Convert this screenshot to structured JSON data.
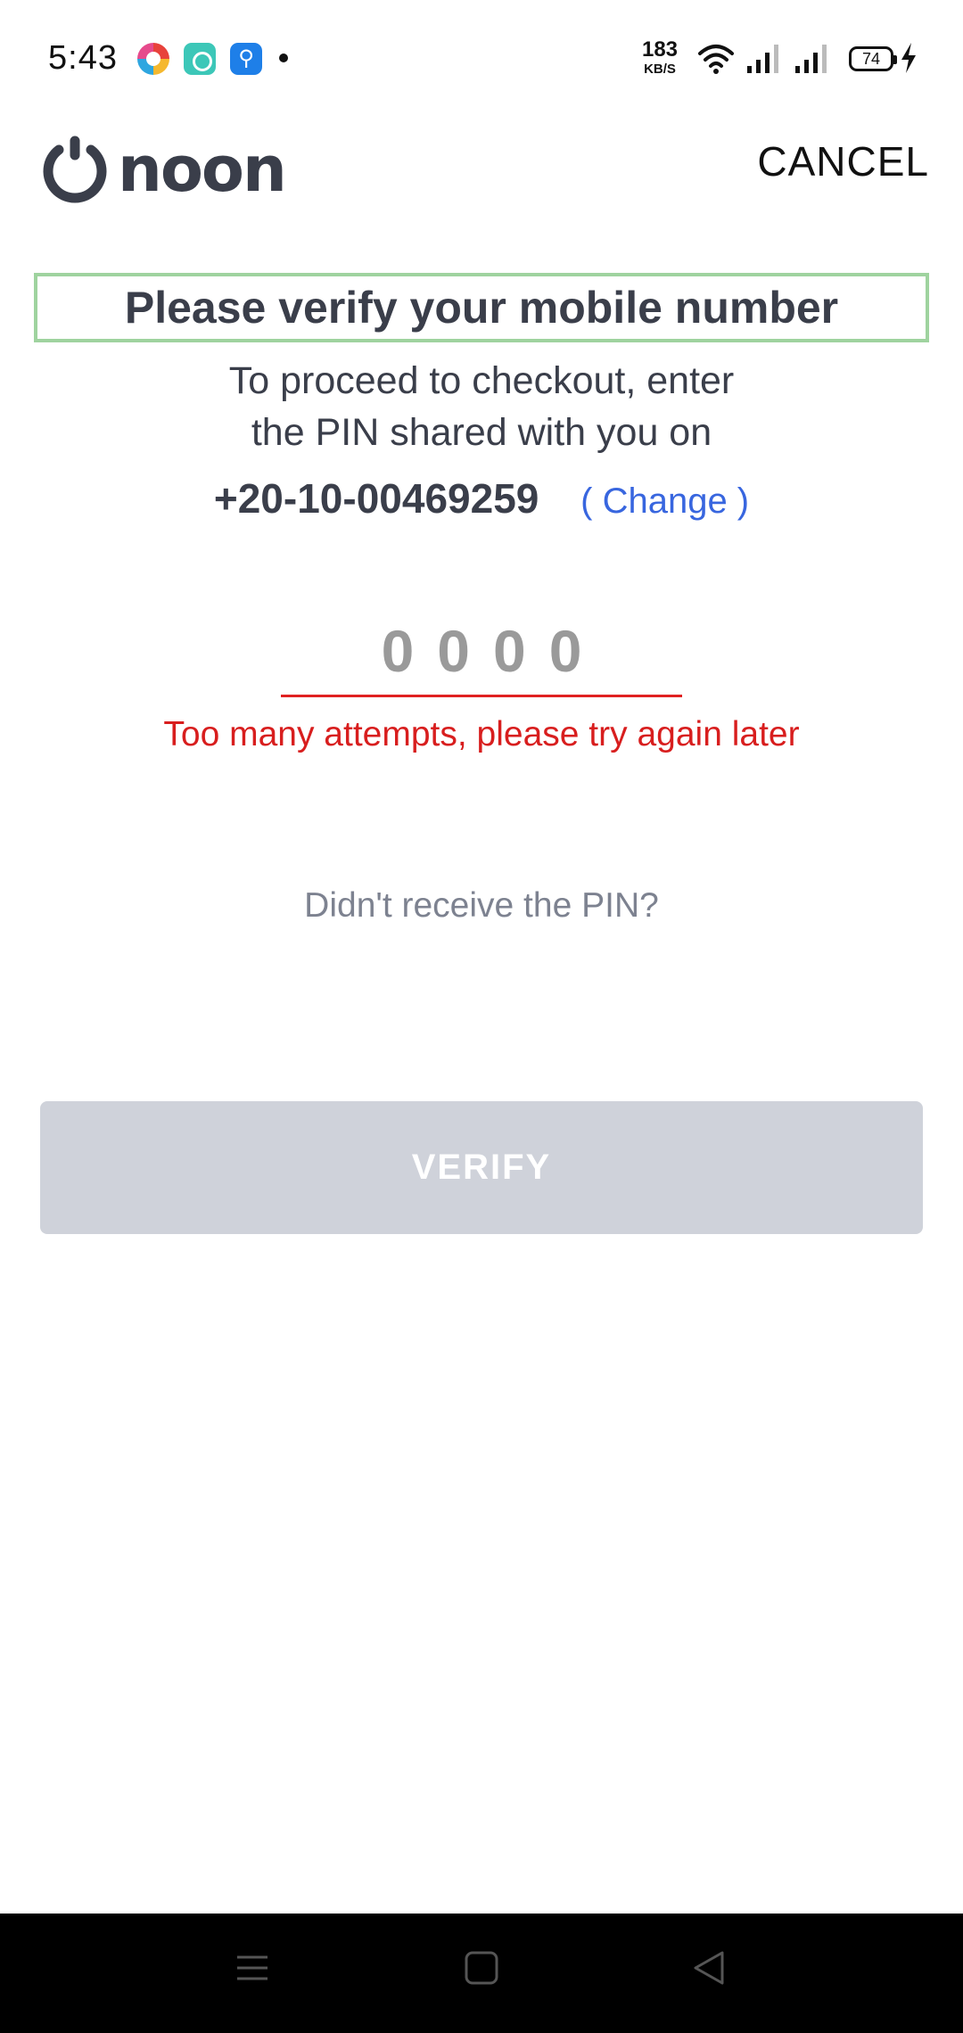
{
  "status_bar": {
    "time": "5:43",
    "net_speed_value": "183",
    "net_speed_unit": "KB/S",
    "battery_level": "74",
    "icons": [
      "browser-app-icon",
      "chat-app-icon",
      "usb-icon",
      "notification-dot",
      "wifi-icon",
      "signal-icon",
      "signal-icon",
      "battery-icon",
      "charging-icon"
    ]
  },
  "header": {
    "logo_text": "noon",
    "cancel_label": "CANCEL"
  },
  "verification": {
    "title": "Please verify your mobile number",
    "subtitle_line1": "To proceed to checkout, enter",
    "subtitle_line2": "the PIN shared with you on",
    "phone_number": "+20-10-00469259",
    "change_label": "( Change )",
    "pin_placeholder": "0000",
    "error_message": "Too many attempts, please try again later",
    "resend_label": "Didn't receive the PIN?",
    "verify_label": "VERIFY"
  },
  "colors": {
    "title_border": "#9fd39f",
    "link": "#3866df",
    "error": "#d81e1e",
    "button_disabled": "#cfd2da",
    "text_primary": "#3a3e4a"
  },
  "nav_bar": {
    "icons": [
      "menu-icon",
      "home-icon",
      "back-icon"
    ]
  }
}
